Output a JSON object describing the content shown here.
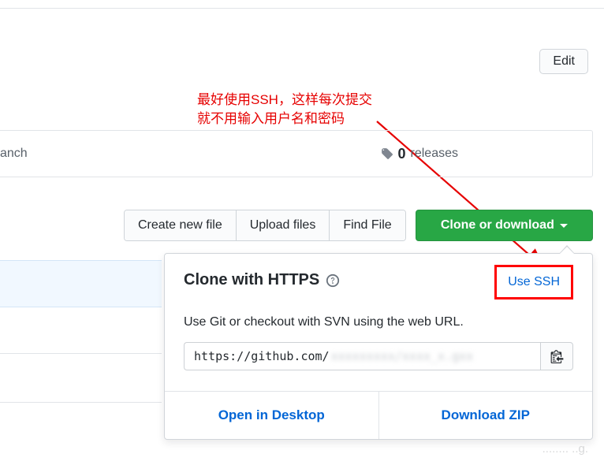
{
  "edit_label": "Edit",
  "annotation": {
    "line1": "最好使用SSH，这样每次提交",
    "line2": "就不用输入用户名和密码"
  },
  "branch_fragment": "anch",
  "releases": {
    "count": "0",
    "label": "releases"
  },
  "toolbar": {
    "create_new_file": "Create new file",
    "upload_files": "Upload files",
    "find_file": "Find File",
    "clone_download": "Clone or download"
  },
  "clone_panel": {
    "title": "Clone with HTTPS",
    "use_ssh": "Use SSH",
    "description": "Use Git or checkout with SVN using the web URL.",
    "url_prefix": "https://github.com/",
    "url_blurred": "xxxxxxxxx/xxxx_x.gxx",
    "open_desktop": "Open in Desktop",
    "download_zip": "Download ZIP"
  },
  "timestamp_fragment": "........ ..g."
}
